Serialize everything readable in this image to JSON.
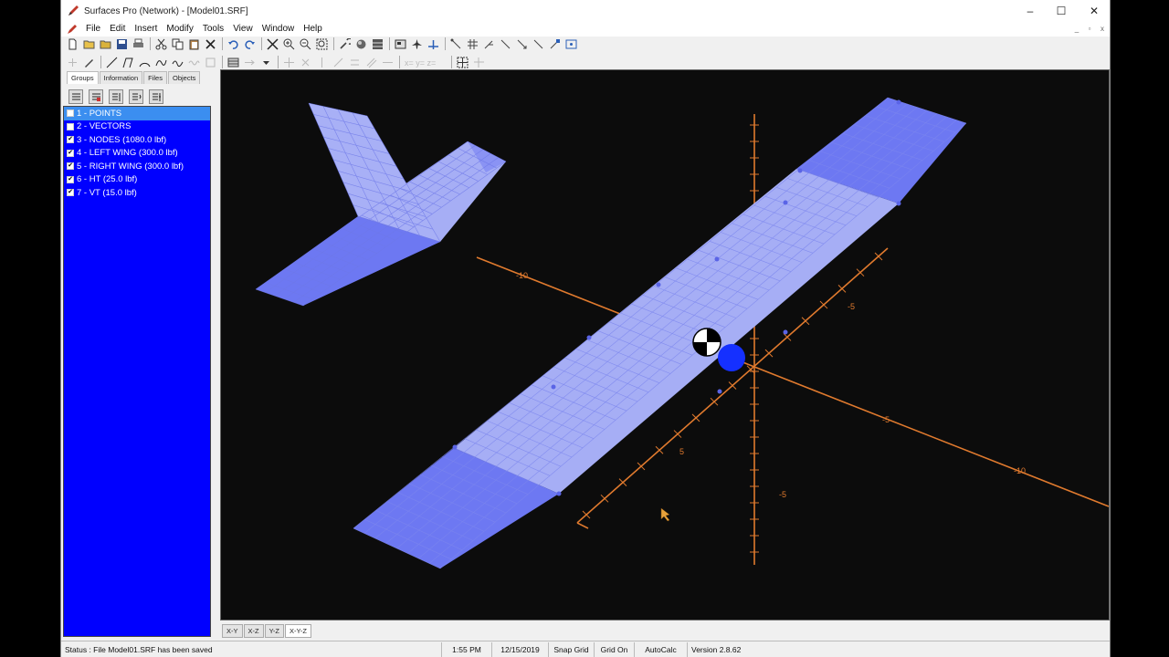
{
  "window": {
    "title": "Surfaces Pro (Network) - [Model01.SRF]"
  },
  "menu": [
    "File",
    "Edit",
    "Insert",
    "Modify",
    "Tools",
    "View",
    "Window",
    "Help"
  ],
  "panel": {
    "tabs": [
      "Groups",
      "Information",
      "Files",
      "Objects"
    ],
    "groups": [
      {
        "label": "1 - POINTS",
        "checked": false,
        "selected": true
      },
      {
        "label": "2 - VECTORS",
        "checked": false,
        "selected": false
      },
      {
        "label": "3 - NODES (1080.0 lbf)",
        "checked": true,
        "selected": false
      },
      {
        "label": "4 - LEFT WING (300.0 lbf)",
        "checked": true,
        "selected": false
      },
      {
        "label": "5 - RIGHT WING (300.0 lbf)",
        "checked": true,
        "selected": false
      },
      {
        "label": "6 - HT (25.0 lbf)",
        "checked": true,
        "selected": false
      },
      {
        "label": "7 - VT (15.0 lbf)",
        "checked": true,
        "selected": false
      }
    ]
  },
  "viewport": {
    "axis_labels": {
      "x_neg": "-10",
      "x_pos": "5",
      "y_pos": "-5",
      "x_far": "-10",
      "mid": "-5",
      "near": "5",
      "z_neg": "-5"
    },
    "colors": {
      "axis": "#e07a2e",
      "wing_light": "#a6aef5",
      "wing_dark": "#6872f0",
      "cg_marker": "#1530ff"
    }
  },
  "view_tabs": [
    "X-Y",
    "X-Z",
    "Y-Z",
    "X-Y-Z"
  ],
  "view_tabs_active": "X-Y-Z",
  "status": {
    "message": "Status : File Model01.SRF has been saved",
    "time": "1:55 PM",
    "date": "12/15/2019",
    "snap": "Snap Grid",
    "grid": "Grid On",
    "autocalc": "AutoCalc ON",
    "version": "Version 2.8.62"
  }
}
